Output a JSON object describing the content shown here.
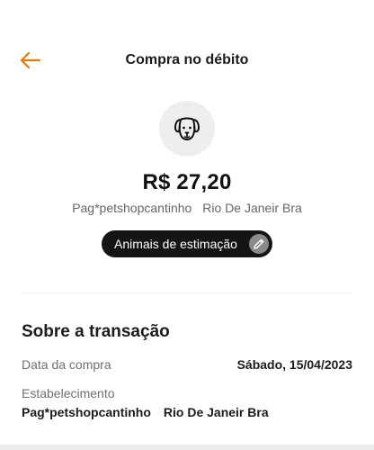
{
  "header": {
    "title": "Compra no débito",
    "back_icon": "arrow-left-icon",
    "accent": "#e07b14"
  },
  "transaction": {
    "category_icon": "dog-icon",
    "amount": "R$ 27,20",
    "merchant": "Pag*petshopcantinho",
    "location": "Rio De Janeir Bra",
    "category_label": "Animais de estimação",
    "edit_icon": "pencil-icon"
  },
  "details": {
    "title": "Sobre a transação",
    "date_label": "Data da compra",
    "date_value": "Sábado, 15/04/2023",
    "establishment_label": "Estabelecimento",
    "establishment_name": "Pag*petshopcantinho",
    "establishment_location": "Rio De Janeir Bra"
  }
}
